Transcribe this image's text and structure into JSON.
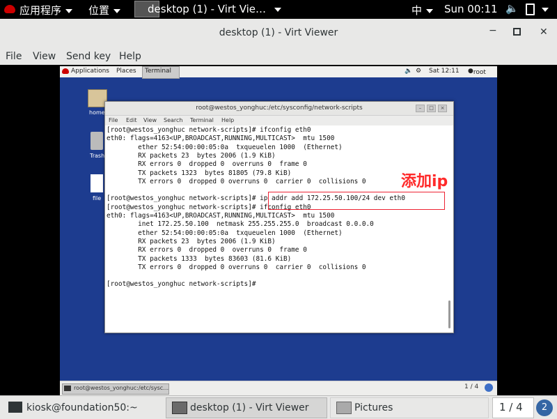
{
  "host": {
    "topbar": {
      "applications": "应用程序",
      "places": "位置",
      "active_window": "desktop (1) - Virt Vie…",
      "input_method": "中",
      "clock": "Sun 00:11"
    },
    "window": {
      "title": "desktop (1) - Virt Viewer",
      "menu": [
        "File",
        "View",
        "Send key",
        "Help"
      ]
    },
    "taskbar": {
      "items": [
        "kiosk@foundation50:~",
        "desktop (1) - Virt Viewer",
        "Pictures"
      ],
      "workspace": "1 / 4"
    }
  },
  "guest": {
    "topbar": {
      "applications": "Applications",
      "places": "Places",
      "terminal_tab": "Terminal",
      "clock": "Sat 12:11",
      "user": "root"
    },
    "desktop_icons": [
      "home",
      "Trash",
      "file"
    ],
    "terminal": {
      "title": "root@westos_yonghuc:/etc/sysconfig/network-scripts",
      "menu": [
        "File",
        "Edit",
        "View",
        "Search",
        "Terminal",
        "Help"
      ],
      "lines": [
        "[root@westos_yonghuc network-scripts]# ifconfig eth0",
        "eth0: flags=4163<UP,BROADCAST,RUNNING,MULTICAST>  mtu 1500",
        "        ether 52:54:00:00:05:0a  txqueuelen 1000  (Ethernet)",
        "        RX packets 23  bytes 2006 (1.9 KiB)",
        "        RX errors 0  dropped 0  overruns 0  frame 0",
        "        TX packets 1323  bytes 81805 (79.8 KiB)",
        "        TX errors 0  dropped 0 overruns 0  carrier 0  collisions 0",
        "",
        "[root@westos_yonghuc network-scripts]# ip addr add 172.25.50.100/24 dev eth0",
        "[root@westos_yonghuc network-scripts]# ifconfig eth0",
        "eth0: flags=4163<UP,BROADCAST,RUNNING,MULTICAST>  mtu 1500",
        "        inet 172.25.50.100  netmask 255.255.255.0  broadcast 0.0.0.0",
        "        ether 52:54:00:00:05:0a  txqueuelen 1000  (Ethernet)",
        "        RX packets 23  bytes 2006 (1.9 KiB)",
        "        RX errors 0  dropped 0  overruns 0  frame 0",
        "        TX packets 1333  bytes 83603 (81.6 KiB)",
        "        TX errors 0  dropped 0 overruns 0  carrier 0  collisions 0",
        "",
        "[root@westos_yonghuc network-scripts]#"
      ]
    },
    "annotation": "添加ip",
    "bottom": {
      "task": "root@westos_yonghuc:/etc/sysc…",
      "workspace": "1 / 4"
    }
  },
  "colors": {
    "guest_desktop": "#1d3c8f",
    "annotation": "#ff2a2a"
  }
}
